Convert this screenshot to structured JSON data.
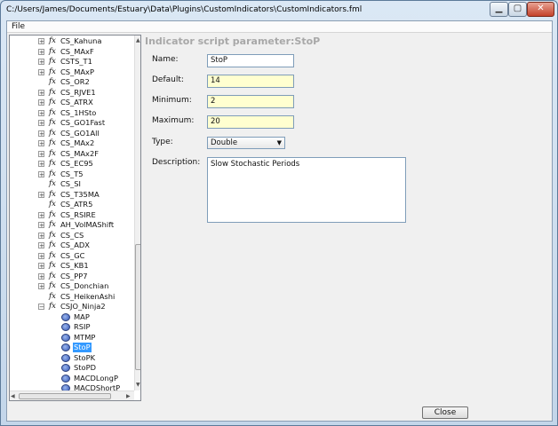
{
  "window": {
    "title": "C:/Users/James/Documents/Estuary\\Data\\Plugins\\CustomIndicators\\CustomIndicators.fml"
  },
  "menu": {
    "file": "File"
  },
  "tree": {
    "fx_glyph": "fx",
    "items": [
      {
        "label": "CS_Kahuna",
        "expandable": true
      },
      {
        "label": "CS_MAxF",
        "expandable": true
      },
      {
        "label": "CSTS_T1",
        "expandable": true
      },
      {
        "label": "CS_MAxP",
        "expandable": true
      },
      {
        "label": "CS_OR2",
        "expandable": false
      },
      {
        "label": "CS_RJVE1",
        "expandable": true
      },
      {
        "label": "CS_ATRX",
        "expandable": true
      },
      {
        "label": "CS_1HSto",
        "expandable": true
      },
      {
        "label": "CS_GO1Fast",
        "expandable": true
      },
      {
        "label": "CS_GO1All",
        "expandable": true
      },
      {
        "label": "CS_MAx2",
        "expandable": true
      },
      {
        "label": "CS_MAx2F",
        "expandable": true
      },
      {
        "label": "CS_EC95",
        "expandable": true
      },
      {
        "label": "CS_T5",
        "expandable": true
      },
      {
        "label": "CS_SI",
        "expandable": false
      },
      {
        "label": "CS_T35MA",
        "expandable": true
      },
      {
        "label": "CS_ATR5",
        "expandable": false
      },
      {
        "label": "CS_RSIRE",
        "expandable": true
      },
      {
        "label": "AH_VolMAShift",
        "expandable": true
      },
      {
        "label": "CS_CS",
        "expandable": true
      },
      {
        "label": "CS_ADX",
        "expandable": true
      },
      {
        "label": "CS_GC",
        "expandable": true
      },
      {
        "label": "CS_KB1",
        "expandable": true
      },
      {
        "label": "CS_PP7",
        "expandable": true
      },
      {
        "label": "CS_Donchian",
        "expandable": true
      },
      {
        "label": "CS_HeikenAshi",
        "expandable": false
      },
      {
        "label": "CSJO_Ninja2",
        "expandable": true,
        "expanded": true
      }
    ],
    "params": [
      "MAP",
      "RSIP",
      "MTMP",
      "StoP",
      "StoPK",
      "StoPD",
      "MACDLongP",
      "MACDShortP"
    ],
    "selected_param": "StoP"
  },
  "panel": {
    "title": "Indicator script parameter:StoP",
    "name_label": "Name:",
    "name_value": "StoP",
    "default_label": "Default:",
    "default_value": "14",
    "minimum_label": "Minimum:",
    "minimum_value": "2",
    "maximum_label": "Maximum:",
    "maximum_value": "20",
    "type_label": "Type:",
    "type_value": "Double",
    "description_label": "Description:",
    "description_value": "Slow Stochastic Periods"
  },
  "buttons": {
    "close": "Close"
  },
  "colors": {
    "selection": "#3399ff",
    "input_yellow": "#ffffd0",
    "title_gray": "#a8a8a8"
  }
}
